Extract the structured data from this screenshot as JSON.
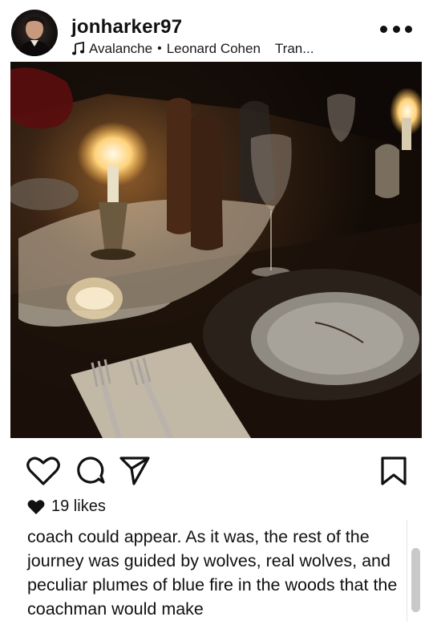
{
  "post": {
    "username": "jonharker97",
    "song_title": "Avalanche",
    "artist": "Leonard Cohen",
    "extra": "Tran...",
    "more_icon": "more-horizontal-icon",
    "likes": "19 likes",
    "caption": "coach could appear. As it was, the rest of the journey was guided by wolves, real wolves, and peculiar plumes of blue fire in the woods that the coachman would make"
  },
  "actions": {
    "like_icon": "heart-outline-icon",
    "comment_icon": "comment-icon",
    "share_icon": "send-icon",
    "save_icon": "bookmark-icon"
  },
  "colors": {
    "text": "#111111",
    "scroll_thumb": "#c9c9c9"
  }
}
